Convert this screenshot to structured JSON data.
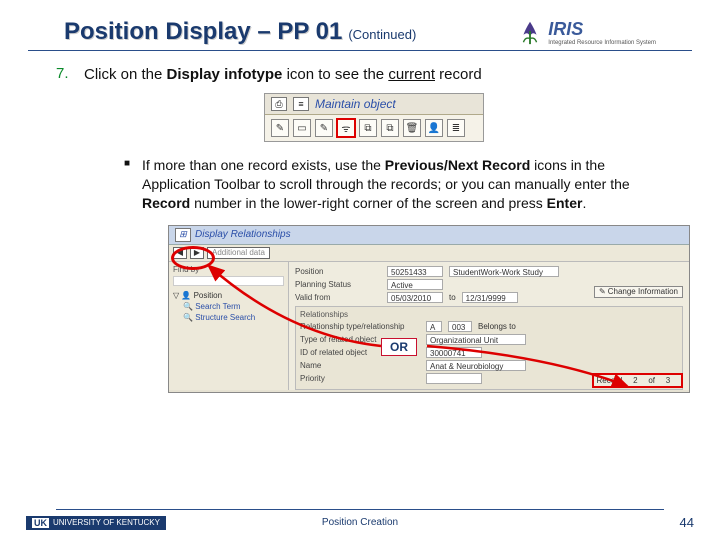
{
  "header": {
    "title": "Position Display – PP 01",
    "continued": "(Continued)",
    "logo_text": "IRIS",
    "logo_sub": "Integrated Resource Information System"
  },
  "step": {
    "number": "7.",
    "prefix": "Click on the ",
    "bold1": "Display infotype",
    "mid": " icon to see the ",
    "underlined": "current",
    "suffix": " record"
  },
  "toolbar": {
    "maintain_label": "Maintain object"
  },
  "bullet": {
    "p1a": "If more than one record exists, use the ",
    "p1b": "Previous/Next Record",
    "p1c": " icons in the Application Toolbar to scroll through the records; or you can manually enter the ",
    "p1d": "Record",
    "p1e": " number in the lower-right corner of the screen and press ",
    "p1f": "Enter",
    "p1g": "."
  },
  "screenshot": {
    "title": "Display Relationships",
    "tab_additional": "Additional data",
    "left": {
      "find_by": "Find by",
      "root": "Position",
      "item1": "Search Term",
      "item2": "Structure Search"
    },
    "fields": {
      "position_lbl": "Position",
      "position_val": "50251433",
      "position_txt": "StudentWork-Work Study",
      "status_lbl": "Planning Status",
      "status_val": "Active",
      "valid_lbl": "Valid from",
      "valid_from": "05/03/2010",
      "valid_to_lbl": "to",
      "valid_to": "12/31/9999",
      "change_btn": "Change Information",
      "rel_section": "Relationships",
      "rel_type_lbl": "Relationship type/relationship",
      "rel_type_val1": "A",
      "rel_type_val2": "003",
      "rel_type_txt": "Belongs to",
      "obj_type_lbl": "Type of related object",
      "obj_type_val": "Organizational Unit",
      "obj_id_lbl": "ID of related object",
      "obj_id_val": "30000741",
      "name_lbl": "Name",
      "name_val": "Anat & Neurobiology",
      "prio_lbl": "Priority"
    },
    "or_label": "OR",
    "record": {
      "lbl": "Record",
      "cur": "2",
      "of": "of",
      "tot": "3"
    }
  },
  "footer": {
    "uk": "UK",
    "uk_text": "UNIVERSITY OF KENTUCKY",
    "center": "Position Creation",
    "page": "44"
  }
}
